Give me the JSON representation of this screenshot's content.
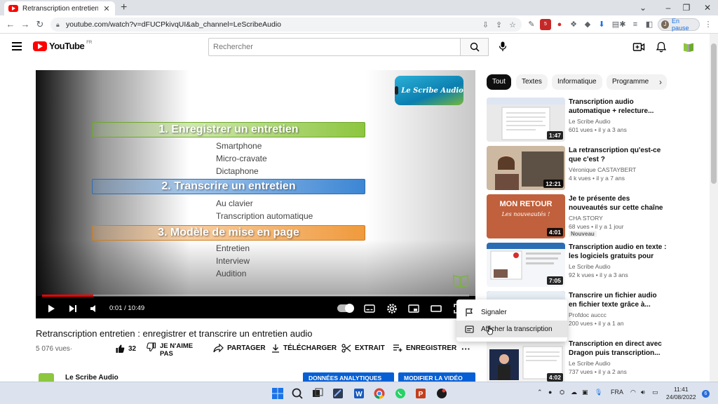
{
  "browser": {
    "tab_title": "Retranscription entretien : enregistrer et transcrire un entretien audio - YouTube",
    "new_tab": "+",
    "url": "youtube.com/watch?v=dFUCPkivqUI&ab_channel=LeScribeAudio",
    "profile_initial": "J",
    "profile_status": "En pause",
    "ext_badge": "5"
  },
  "header": {
    "logo_text": "YouTube",
    "logo_region": "FR",
    "search_placeholder": "Rechercher"
  },
  "video": {
    "slide": {
      "logo": "Le Scribe Audio",
      "section1": "1. Enregistrer un entretien",
      "items1": [
        "Smartphone",
        "Micro-cravate",
        "Dictaphone"
      ],
      "section2": "2. Transcrire un entretien",
      "items2": [
        "Au clavier",
        "Transcription automatique"
      ],
      "section3": "3. Modèle de mise en page",
      "items3": [
        "Entretien",
        "Interview",
        "Audition"
      ]
    },
    "time": "0:01 / 10:49",
    "progress": 0.12,
    "title": "Retranscription entretien : enregistrer et transcrire un entretien audio",
    "views": "5 076 vues·",
    "likes": "32",
    "dislike": "JE N'AIME PAS",
    "share": "PARTAGER",
    "download": "TÉLÉCHARGER",
    "clip": "EXTRAIT",
    "save": "ENREGISTRER",
    "more": "···",
    "channel": "Le Scribe Audio",
    "btn_analytics": "DONNÉES ANALYTIQUES",
    "btn_edit": "MODIFIER LA VIDÉO"
  },
  "menu": {
    "items": [
      "Signaler",
      "Afficher la transcription"
    ]
  },
  "chips": [
    "Tout",
    "Textes",
    "Informatique",
    "Programme"
  ],
  "recommendations": [
    {
      "title": "Transcription audio automatique + relecture...",
      "channel": "Le Scribe Audio",
      "meta": "601 vues • il y a 3 ans",
      "duration": "1:47",
      "badge": ""
    },
    {
      "title": "La retranscription qu'est-ce que c'est ?",
      "channel": "Véronique CASTAYBERT",
      "meta": "4 k vues • il y a 7 ans",
      "duration": "12:21",
      "badge": ""
    },
    {
      "title": "Je te présente des nouveautés sur cette chaîne !",
      "channel": "CHA STORY",
      "meta": "68 vues • il y a 1 jour",
      "duration": "4:01",
      "badge": "Nouveau",
      "thumb_line1": "MON RETOUR",
      "thumb_line2": "Les nouveautés !"
    },
    {
      "title": "Transcription audio en texte : les logiciels gratuits pour une...",
      "channel": "Le Scribe Audio",
      "meta": "92 k vues • il y a 3 ans",
      "duration": "7:05",
      "badge": ""
    },
    {
      "title": "Transcrire un fichier audio en fichier texte grâce à...",
      "channel": "Profdoc auccc",
      "meta": "200 vues • il y a 1 an",
      "duration": "",
      "badge": ""
    },
    {
      "title": "Transcription en direct avec Dragon puis transcription...",
      "channel": "Le Scribe Audio",
      "meta": "737 vues • il y a 2 ans",
      "duration": "4:02",
      "badge": ""
    }
  ],
  "taskbar": {
    "lang": "FRA",
    "time": "11:41",
    "date": "24/08/2022",
    "notif": "6"
  }
}
